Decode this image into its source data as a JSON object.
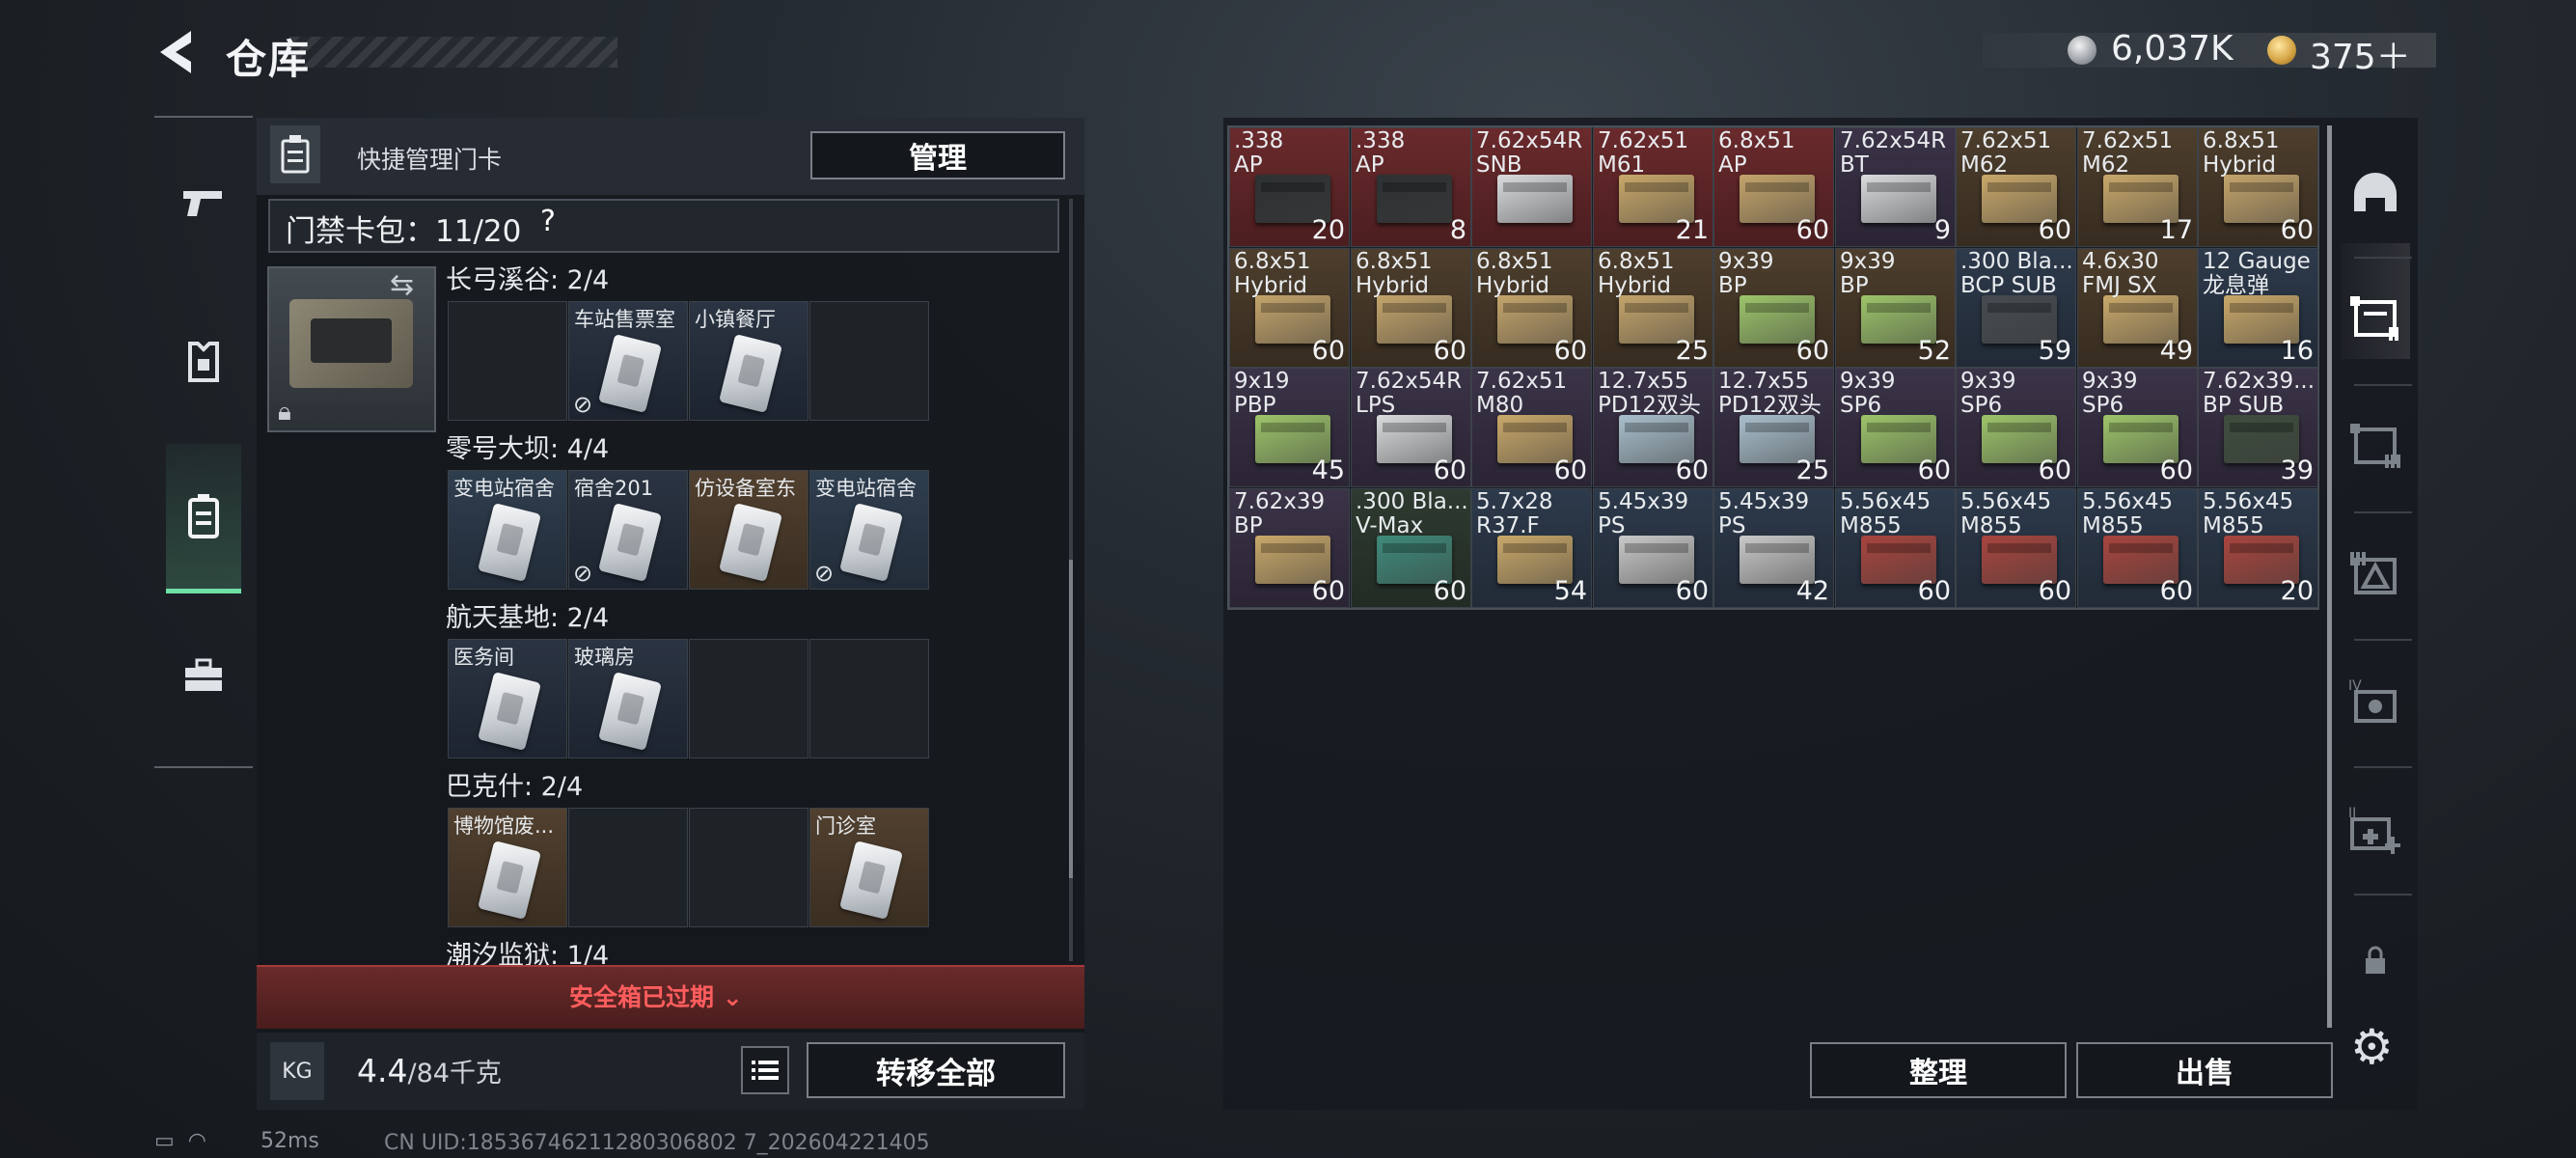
{
  "header": {
    "title": "仓库",
    "currency1": "6,037K",
    "currency2": "375＋"
  },
  "left_nav": [
    "gun-icon",
    "armor-icon",
    "keycard-icon",
    "toolbox-icon"
  ],
  "panel": {
    "quick_manage_label": "快捷管理门卡",
    "manage_button": "管理",
    "bag_label": "门禁卡包：11/20",
    "bag_help": "?",
    "groups": [
      {
        "title": "长弓溪谷: 2/4",
        "slots": [
          {
            "name": "",
            "style": "empty"
          },
          {
            "name": "车站售票室",
            "style": "card",
            "unusable": true
          },
          {
            "name": "小镇餐厅",
            "style": "card",
            "unusable": false
          },
          {
            "name": "",
            "style": "empty"
          }
        ]
      },
      {
        "title": "零号大坝: 4/4",
        "slots": [
          {
            "name": "变电站宿舍",
            "style": "blue",
            "unusable": false
          },
          {
            "name": "宿舍201",
            "style": "card",
            "unusable": true
          },
          {
            "name": "仿设备室东",
            "style": "brown",
            "unusable": false
          },
          {
            "name": "变电站宿舍",
            "style": "blue",
            "unusable": true
          }
        ]
      },
      {
        "title": "航天基地: 2/4",
        "slots": [
          {
            "name": "医务间",
            "style": "card",
            "unusable": false
          },
          {
            "name": "玻璃房",
            "style": "card",
            "unusable": false
          },
          {
            "name": "",
            "style": "empty"
          },
          {
            "name": "",
            "style": "empty"
          }
        ]
      },
      {
        "title": "巴克什: 2/4",
        "slots": [
          {
            "name": "博物馆废...",
            "style": "brown",
            "unusable": false
          },
          {
            "name": "",
            "style": "empty"
          },
          {
            "name": "",
            "style": "empty"
          },
          {
            "name": "门诊室",
            "style": "brown",
            "unusable": false
          }
        ]
      },
      {
        "title": "潮汐监狱: 1/4",
        "slots": []
      }
    ],
    "expired_text": "安全箱已过期",
    "weight_value": "4.4",
    "weight_max": "/84千克",
    "weight_icon_label": "KG",
    "transfer_button": "转移全部"
  },
  "inventory": [
    {
      "name": ".338\nAP",
      "count": "20",
      "bg": "rs",
      "box": "#2e3133"
    },
    {
      "name": ".338\nAP",
      "count": "8",
      "bg": "rs",
      "box": "#2e3133"
    },
    {
      "name": "7.62x54R\nSNB",
      "count": "",
      "bg": "rs",
      "box": "#d9dbdd"
    },
    {
      "name": "7.62x51\nM61",
      "count": "21",
      "bg": "rs",
      "box": "#c9a86a"
    },
    {
      "name": "6.8x51\nAP",
      "count": "60",
      "bg": "rs",
      "box": "#c4a46b"
    },
    {
      "name": "7.62x54R\nBT",
      "count": "9",
      "bg": "pu",
      "box": "#d9dbdd"
    },
    {
      "name": "7.62x51\nM62",
      "count": "60",
      "bg": "br",
      "box": "#c9a86a"
    },
    {
      "name": "7.62x51\nM62",
      "count": "17",
      "bg": "br",
      "box": "#c9a86a"
    },
    {
      "name": "6.8x51\nHybrid",
      "count": "60",
      "bg": "br",
      "box": "#c4a46b"
    },
    {
      "name": "6.8x51\nHybrid",
      "count": "60",
      "bg": "br",
      "box": "#c4a46b"
    },
    {
      "name": "6.8x51\nHybrid",
      "count": "60",
      "bg": "br",
      "box": "#c4a46b"
    },
    {
      "name": "6.8x51\nHybrid",
      "count": "60",
      "bg": "br",
      "box": "#c4a46b"
    },
    {
      "name": "6.8x51\nHybrid",
      "count": "25",
      "bg": "br",
      "box": "#c4a46b"
    },
    {
      "name": "9x39\nBP",
      "count": "60",
      "bg": "br",
      "box": "#9dc46a"
    },
    {
      "name": "9x39\nBP",
      "count": "52",
      "bg": "br",
      "box": "#9dc46a"
    },
    {
      "name": ".300 Bla...\nBCP SUB",
      "count": "59",
      "bg": "bl",
      "box": "#454b50"
    },
    {
      "name": "4.6x30\nFMJ SX",
      "count": "49",
      "bg": "br",
      "box": "#c9a86a"
    },
    {
      "name": "12 Gauge\n龙息弹",
      "count": "16",
      "bg": "bl",
      "box": "#c9a86a"
    },
    {
      "name": "9x19\nPBP",
      "count": "45",
      "bg": "pu",
      "box": "#9dc46a"
    },
    {
      "name": "7.62x54R\nLPS",
      "count": "60",
      "bg": "pu",
      "box": "#d9dbdd"
    },
    {
      "name": "7.62x51\nM80",
      "count": "60",
      "bg": "pu",
      "box": "#c9a86a"
    },
    {
      "name": "12.7x55\nPD12双头",
      "count": "60",
      "bg": "pu",
      "box": "#a9bfcc"
    },
    {
      "name": "12.7x55\nPD12双头",
      "count": "25",
      "bg": "pu",
      "box": "#a9bfcc"
    },
    {
      "name": "9x39\nSP6",
      "count": "60",
      "bg": "pu",
      "box": "#9dc46a"
    },
    {
      "name": "9x39\nSP6",
      "count": "60",
      "bg": "pu",
      "box": "#9dc46a"
    },
    {
      "name": "9x39\nSP6",
      "count": "60",
      "bg": "pu",
      "box": "#9dc46a"
    },
    {
      "name": "7.62x39...\nBP SUB",
      "count": "39",
      "bg": "pu",
      "box": "#3e4d3e"
    },
    {
      "name": "7.62x39\nBP",
      "count": "60",
      "bg": "pu",
      "box": "#c9a86a"
    },
    {
      "name": ".300 Bla...\nV-Max",
      "count": "60",
      "bg": "gr",
      "box": "#3e8a7a"
    },
    {
      "name": "5.7x28\nR37.F",
      "count": "54",
      "bg": "bl",
      "box": "#c9a86a"
    },
    {
      "name": "5.45x39\nPS",
      "count": "60",
      "bg": "bl",
      "box": "#c9c9c9"
    },
    {
      "name": "5.45x39\nPS",
      "count": "42",
      "bg": "bl",
      "box": "#c9c9c9"
    },
    {
      "name": "5.56x45\nM855",
      "count": "60",
      "bg": "bl",
      "box": "#a8453e"
    },
    {
      "name": "5.56x45\nM855",
      "count": "60",
      "bg": "bl",
      "box": "#a8453e"
    },
    {
      "name": "5.56x45\nM855",
      "count": "60",
      "bg": "bl",
      "box": "#a8453e"
    },
    {
      "name": "5.56x45\nM855",
      "count": "20",
      "bg": "bl",
      "box": "#a8453e"
    }
  ],
  "actions": {
    "sort": "整理",
    "sell": "出售"
  },
  "right_nav": [
    "helmet-icon",
    "storage-1-icon",
    "storage-2-icon",
    "storage-3-icon",
    "storage-4-icon",
    "storage-add-icon",
    "lock-icon"
  ],
  "status": {
    "ping": "52ms",
    "uid": "CN UID:18536746211280306802 7_202604221405"
  }
}
